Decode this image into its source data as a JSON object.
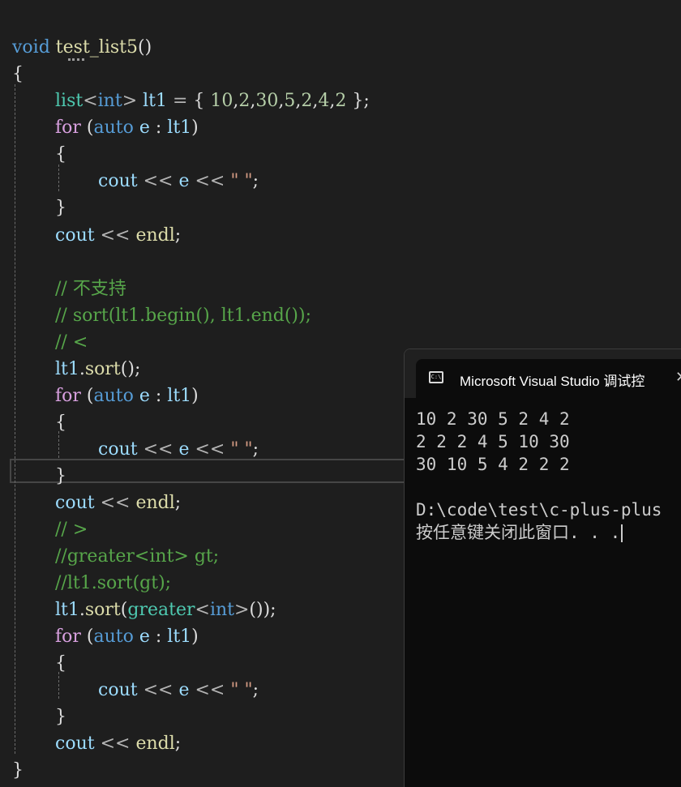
{
  "editor": {
    "lines": [
      [
        {
          "c": "kw",
          "t": "void"
        },
        {
          "c": "punc",
          "t": " "
        },
        {
          "c": "fn",
          "t": "test_list5"
        },
        {
          "c": "punc",
          "t": "()"
        }
      ],
      [
        {
          "c": "punc",
          "t": "{"
        }
      ],
      [
        {
          "c": "type",
          "t": "list"
        },
        {
          "c": "op",
          "t": "<"
        },
        {
          "c": "kw",
          "t": "int"
        },
        {
          "c": "op",
          "t": ">"
        },
        {
          "c": "punc",
          "t": " "
        },
        {
          "c": "var",
          "t": "lt1"
        },
        {
          "c": "punc",
          "t": " "
        },
        {
          "c": "op",
          "t": "="
        },
        {
          "c": "punc",
          "t": " { "
        },
        {
          "c": "num",
          "t": "10"
        },
        {
          "c": "punc",
          "t": ","
        },
        {
          "c": "num",
          "t": "2"
        },
        {
          "c": "punc",
          "t": ","
        },
        {
          "c": "num",
          "t": "30"
        },
        {
          "c": "punc",
          "t": ","
        },
        {
          "c": "num",
          "t": "5"
        },
        {
          "c": "punc",
          "t": ","
        },
        {
          "c": "num",
          "t": "2"
        },
        {
          "c": "punc",
          "t": ","
        },
        {
          "c": "num",
          "t": "4"
        },
        {
          "c": "punc",
          "t": ","
        },
        {
          "c": "num",
          "t": "2"
        },
        {
          "c": "punc",
          "t": " };"
        }
      ],
      [
        {
          "c": "ctl",
          "t": "for"
        },
        {
          "c": "punc",
          "t": " ("
        },
        {
          "c": "kw",
          "t": "auto"
        },
        {
          "c": "punc",
          "t": " "
        },
        {
          "c": "var",
          "t": "e"
        },
        {
          "c": "punc",
          "t": " : "
        },
        {
          "c": "var",
          "t": "lt1"
        },
        {
          "c": "punc",
          "t": ")"
        }
      ],
      [
        {
          "c": "punc",
          "t": "{"
        }
      ],
      [
        {
          "c": "var",
          "t": "cout"
        },
        {
          "c": "punc",
          "t": " "
        },
        {
          "c": "op",
          "t": "<<"
        },
        {
          "c": "punc",
          "t": " "
        },
        {
          "c": "var",
          "t": "e"
        },
        {
          "c": "punc",
          "t": " "
        },
        {
          "c": "op",
          "t": "<<"
        },
        {
          "c": "punc",
          "t": " "
        },
        {
          "c": "str",
          "t": "\" \""
        },
        {
          "c": "punc",
          "t": ";"
        }
      ],
      [
        {
          "c": "punc",
          "t": "}"
        }
      ],
      [
        {
          "c": "var",
          "t": "cout"
        },
        {
          "c": "punc",
          "t": " "
        },
        {
          "c": "op",
          "t": "<<"
        },
        {
          "c": "punc",
          "t": " "
        },
        {
          "c": "fn",
          "t": "endl"
        },
        {
          "c": "punc",
          "t": ";"
        }
      ],
      [],
      [
        {
          "c": "cmt",
          "t": "// 不支持"
        }
      ],
      [
        {
          "c": "cmt",
          "t": "// sort(lt1.begin(), lt1.end());"
        }
      ],
      [
        {
          "c": "cmt",
          "t": "// <"
        }
      ],
      [
        {
          "c": "var",
          "t": "lt1"
        },
        {
          "c": "punc",
          "t": "."
        },
        {
          "c": "fn",
          "t": "sort"
        },
        {
          "c": "punc",
          "t": "();"
        }
      ],
      [
        {
          "c": "ctl",
          "t": "for"
        },
        {
          "c": "punc",
          "t": " ("
        },
        {
          "c": "kw",
          "t": "auto"
        },
        {
          "c": "punc",
          "t": " "
        },
        {
          "c": "var",
          "t": "e"
        },
        {
          "c": "punc",
          "t": " : "
        },
        {
          "c": "var",
          "t": "lt1"
        },
        {
          "c": "punc",
          "t": ")"
        }
      ],
      [
        {
          "c": "punc",
          "t": "{"
        }
      ],
      [
        {
          "c": "var",
          "t": "cout"
        },
        {
          "c": "punc",
          "t": " "
        },
        {
          "c": "op",
          "t": "<<"
        },
        {
          "c": "punc",
          "t": " "
        },
        {
          "c": "var",
          "t": "e"
        },
        {
          "c": "punc",
          "t": " "
        },
        {
          "c": "op",
          "t": "<<"
        },
        {
          "c": "punc",
          "t": " "
        },
        {
          "c": "str",
          "t": "\" \""
        },
        {
          "c": "punc",
          "t": ";"
        }
      ],
      [
        {
          "c": "punc",
          "t": "}"
        }
      ],
      [
        {
          "c": "var",
          "t": "cout"
        },
        {
          "c": "punc",
          "t": " "
        },
        {
          "c": "op",
          "t": "<<"
        },
        {
          "c": "punc",
          "t": " "
        },
        {
          "c": "fn",
          "t": "endl"
        },
        {
          "c": "punc",
          "t": ";"
        }
      ],
      [
        {
          "c": "cmt",
          "t": "// >"
        }
      ],
      [
        {
          "c": "cmt",
          "t": "//greater<int> gt;"
        }
      ],
      [
        {
          "c": "cmt",
          "t": "//lt1.sort(gt);"
        }
      ],
      [
        {
          "c": "var",
          "t": "lt1"
        },
        {
          "c": "punc",
          "t": "."
        },
        {
          "c": "fn",
          "t": "sort"
        },
        {
          "c": "punc",
          "t": "("
        },
        {
          "c": "type",
          "t": "greater"
        },
        {
          "c": "op",
          "t": "<"
        },
        {
          "c": "kw",
          "t": "int"
        },
        {
          "c": "op",
          "t": ">"
        },
        {
          "c": "punc",
          "t": "());"
        }
      ],
      [
        {
          "c": "ctl",
          "t": "for"
        },
        {
          "c": "punc",
          "t": " ("
        },
        {
          "c": "kw",
          "t": "auto"
        },
        {
          "c": "punc",
          "t": " "
        },
        {
          "c": "var",
          "t": "e"
        },
        {
          "c": "punc",
          "t": " : "
        },
        {
          "c": "var",
          "t": "lt1"
        },
        {
          "c": "punc",
          "t": ")"
        }
      ],
      [
        {
          "c": "punc",
          "t": "{"
        }
      ],
      [
        {
          "c": "var",
          "t": "cout"
        },
        {
          "c": "punc",
          "t": " "
        },
        {
          "c": "op",
          "t": "<<"
        },
        {
          "c": "punc",
          "t": " "
        },
        {
          "c": "var",
          "t": "e"
        },
        {
          "c": "punc",
          "t": " "
        },
        {
          "c": "op",
          "t": "<<"
        },
        {
          "c": "punc",
          "t": " "
        },
        {
          "c": "str",
          "t": "\" \""
        },
        {
          "c": "punc",
          "t": ";"
        }
      ],
      [
        {
          "c": "punc",
          "t": "}"
        }
      ],
      [
        {
          "c": "var",
          "t": "cout"
        },
        {
          "c": "punc",
          "t": " "
        },
        {
          "c": "op",
          "t": "<<"
        },
        {
          "c": "punc",
          "t": " "
        },
        {
          "c": "fn",
          "t": "endl"
        },
        {
          "c": "punc",
          "t": ";"
        }
      ],
      [
        {
          "c": "punc",
          "t": "}"
        }
      ]
    ]
  },
  "console": {
    "title": "Microsoft Visual Studio 调试控",
    "icon_label": "C:\\",
    "close_glyph": "✕",
    "output_lines": [
      "10 2 30 5 2 4 2",
      "2 2 2 4 5 10 30",
      "30 10 5 4 2 2 2",
      "",
      "D:\\code\\test\\c-plus-plus",
      "按任意键关闭此窗口. . ."
    ]
  },
  "colors": {
    "editor_background": "#1e1e1e",
    "keyword": "#569cd6",
    "control": "#d8a0df",
    "function": "#dcdcaa",
    "variable": "#9cdcfe",
    "type": "#4ec9b0",
    "number": "#b5cea8",
    "string": "#d69d85",
    "comment": "#57a64a",
    "console_background": "#0c0c0c"
  }
}
